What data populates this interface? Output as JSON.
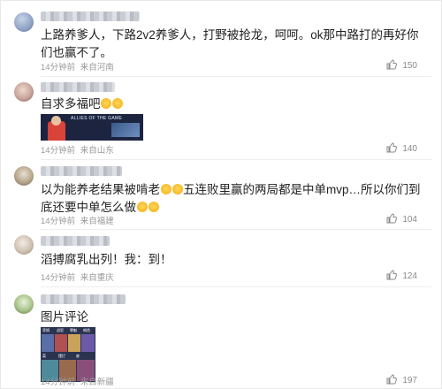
{
  "comments": [
    {
      "text": "上路养爹人，下路2v2养爹人，打野被抢龙，呵呵。ok那中路打的再好你们也赢不了。",
      "time": "14分钟前",
      "source": "来自河南",
      "likes": "150"
    },
    {
      "text": "自求多福吧",
      "emojis": [
        "😮",
        "😮"
      ],
      "image_caption": "ALLIES OF THE GAME",
      "time": "14分钟前",
      "source": "来自山东",
      "likes": "140"
    },
    {
      "text_a": "以为能养老结果被啃老",
      "text_b": "五连败里赢的两局都是中单mvp…所以你们到底还要中单怎么做",
      "time": "14分钟前",
      "source": "来自福建",
      "likes": "104"
    },
    {
      "text": "滔搏腐乳出列！我：到！",
      "time": "14分钟前",
      "source": "来自重庆",
      "likes": "124"
    },
    {
      "text": "图片评论",
      "image_labels": [
        "背锅",
        "战犯",
        "罪魁",
        "祸首",
        "菜",
        "摆烂",
        "废"
      ],
      "time": "14分钟前",
      "source": "来自新疆",
      "likes": "197"
    }
  ],
  "colors": {
    "text": "#222222",
    "meta": "#9a9a9a",
    "divider": "#eeeeee",
    "like": "#8a8a8a"
  }
}
